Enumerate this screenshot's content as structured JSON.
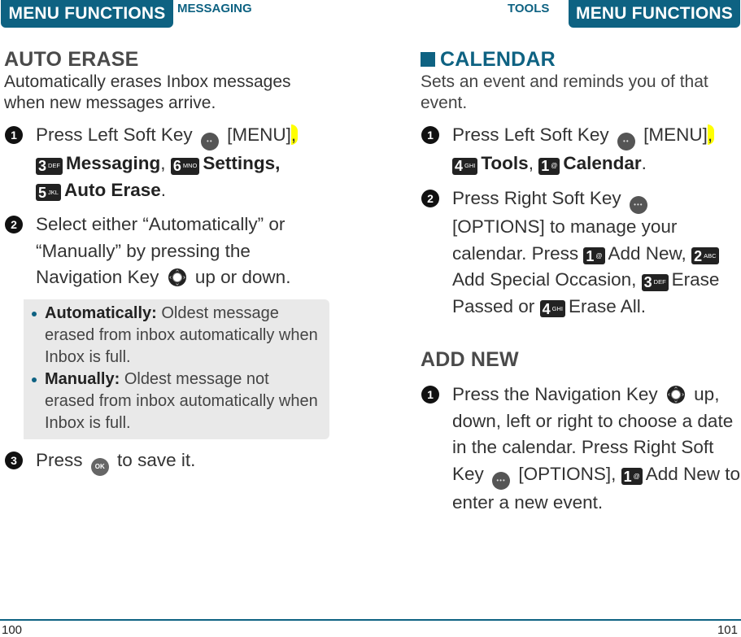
{
  "header": {
    "left_tab": "MENU FUNCTIONS",
    "left_section": "MESSAGING",
    "right_section": "TOOLS",
    "right_tab": "MENU FUNCTIONS"
  },
  "left": {
    "title": "AUTO ERASE",
    "description": "Automatically erases Inbox messages when new messages arrive.",
    "step1": {
      "num": "1",
      "text_a": "Press Left Soft Key",
      "softkey_glyph": "••",
      "text_b": "[MENU]",
      "comma": ",",
      "key1": {
        "digit": "3",
        "letters": "DEF"
      },
      "item1": "Messaging",
      "sep1": ",",
      "key2": {
        "digit": "6",
        "letters": "MNO"
      },
      "item2": "Settings,",
      "key3": {
        "digit": "5",
        "letters": "JKL"
      },
      "item3": "Auto Erase",
      "end": "."
    },
    "step2": {
      "num": "2",
      "text_a": "Select either “Automatically” or “Manually” by pressing the Navigation Key",
      "text_b": "up or down."
    },
    "note": [
      {
        "label": "Automatically:",
        "text": "Oldest message erased from inbox automatically when Inbox is full."
      },
      {
        "label": "Manually:",
        "text": "Oldest message not erased from inbox automatically when Inbox is full."
      }
    ],
    "step3": {
      "num": "3",
      "text_a": "Press",
      "ok_glyph": "OK",
      "text_b": "to save it."
    }
  },
  "right": {
    "title": "CALENDAR",
    "description": "Sets an event and reminds you of that event.",
    "step1": {
      "num": "1",
      "text_a": "Press Left Soft Key",
      "softkey_glyph": "••",
      "text_b": "[MENU]",
      "comma": ",",
      "key1": {
        "digit": "4",
        "letters": "GHI"
      },
      "item1": "Tools",
      "sep1": ",",
      "key2": {
        "digit": "1",
        "letters": "@"
      },
      "item2": "Calendar",
      "end": "."
    },
    "step2": {
      "num": "2",
      "text_a": "Press Right Soft Key",
      "softkey_glyph": "•••",
      "text_b": "[OPTIONS] to manage your calendar. Press",
      "key1": {
        "digit": "1",
        "letters": "@"
      },
      "opt1": "Add New,",
      "key2": {
        "digit": "2",
        "letters": "ABC"
      },
      "opt2": "Add Special Occasion,",
      "key3": {
        "digit": "3",
        "letters": "DEF"
      },
      "opt3": "Erase Passed or",
      "key4": {
        "digit": "4",
        "letters": "GHI"
      },
      "opt4": "Erase All."
    },
    "subheading": "ADD NEW",
    "addnew_step1": {
      "num": "1",
      "text_a": "Press the Navigation Key",
      "text_b": "up, down, left or right to choose a date in the calendar. Press Right Soft Key",
      "softkey_glyph": "•••",
      "text_c": "[OPTIONS],",
      "key1": {
        "digit": "1",
        "letters": "@"
      },
      "text_d": "Add New to enter a new event."
    }
  },
  "footer": {
    "page_left": "100",
    "page_right": "101"
  },
  "colors": {
    "brand_blue": "#0e6282",
    "note_bg": "#e9e9e9",
    "highlight": "#ffff00"
  }
}
